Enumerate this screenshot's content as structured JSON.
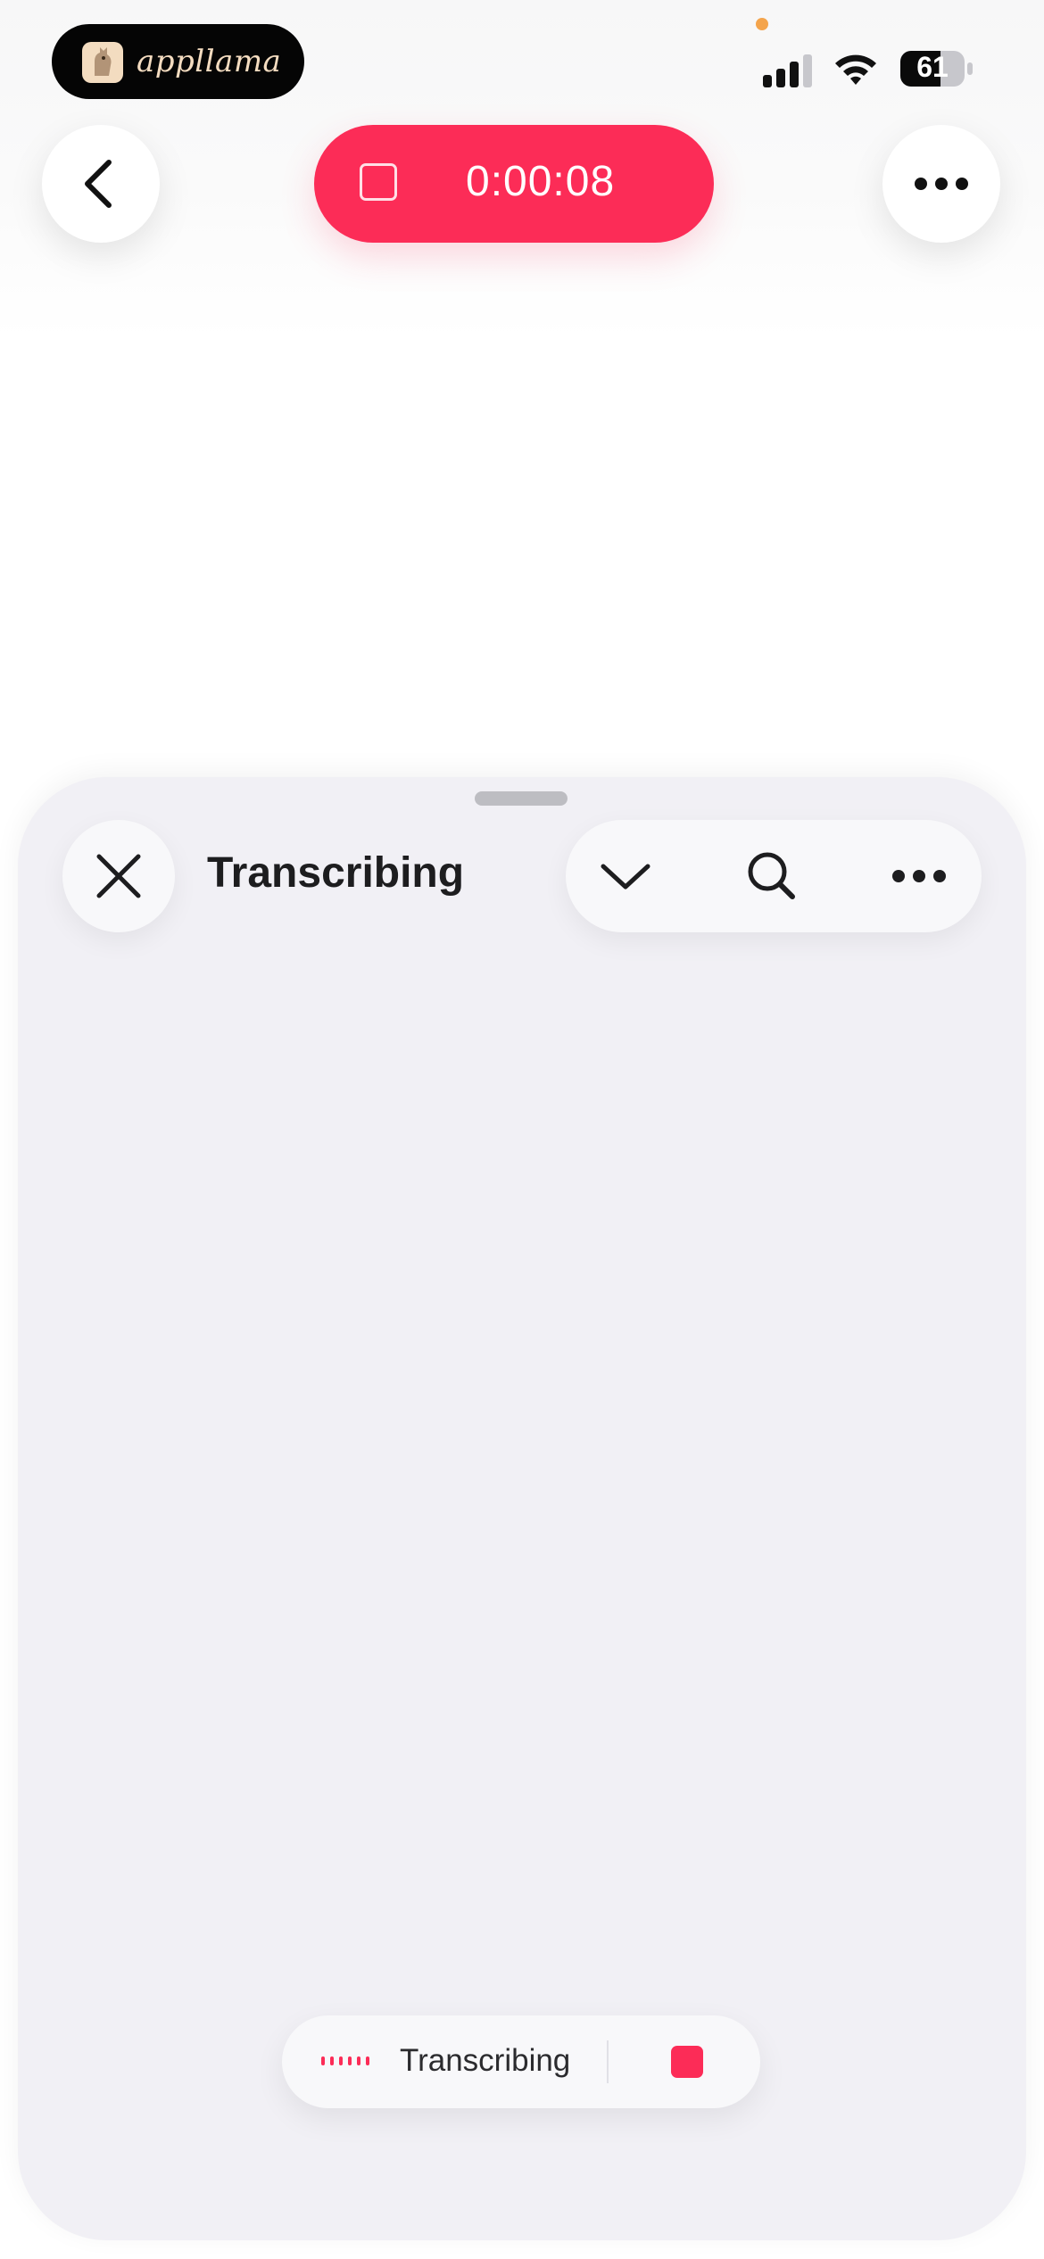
{
  "status_bar": {
    "app_name": "appllama",
    "battery_level": "61",
    "battery_percent": 61
  },
  "top_nav": {
    "back_icon": "chevron-left-icon",
    "recording_time": "0:00:08",
    "more_icon": "ellipsis-icon"
  },
  "sheet": {
    "title": "Transcribing",
    "toolbar_icons": [
      "chevron-down-icon",
      "search-icon",
      "ellipsis-icon"
    ]
  },
  "status_pill": {
    "label": "Transcribing"
  },
  "colors": {
    "accent": "#fc2c57",
    "sheet_background": "#f1f0f5",
    "text": "#1d1d1f"
  }
}
